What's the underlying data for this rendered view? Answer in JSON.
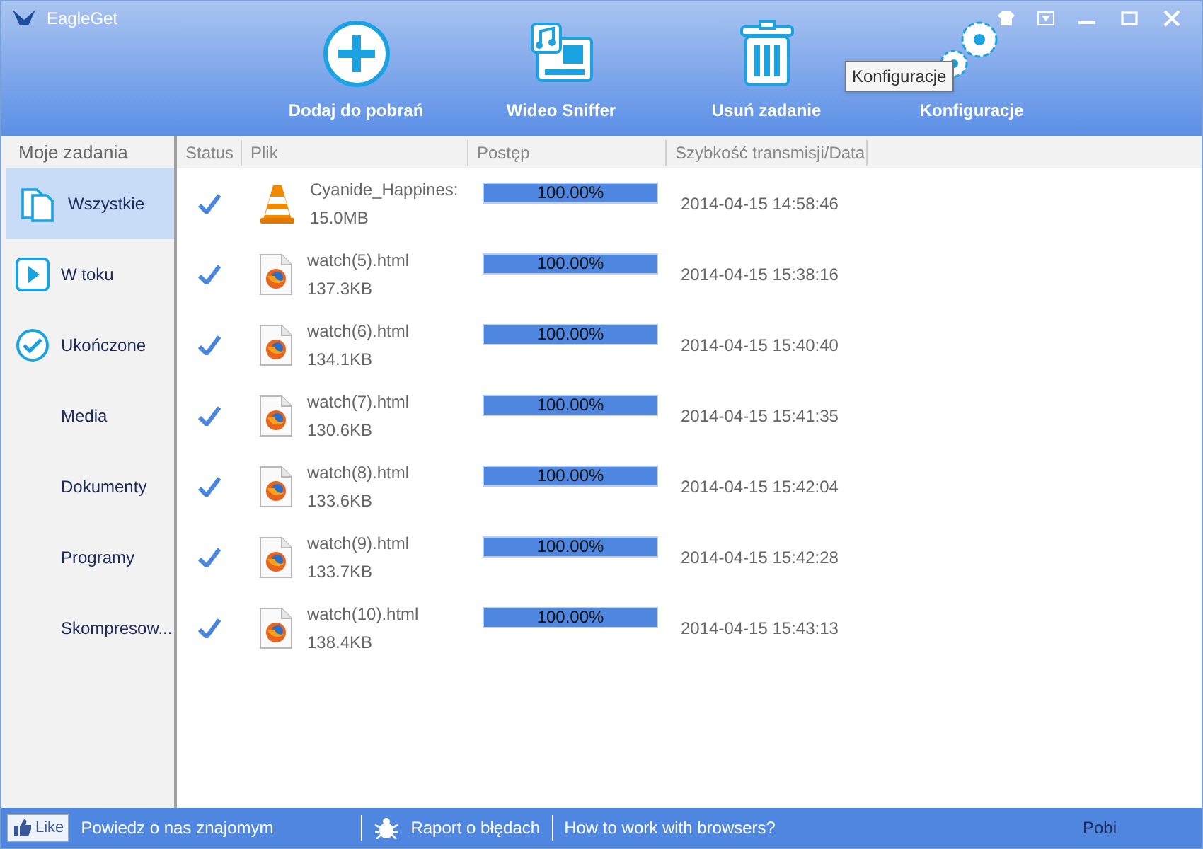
{
  "window": {
    "title": "EagleGet"
  },
  "toolbar": [
    {
      "label": "Dodaj do pobrań",
      "kind": "add"
    },
    {
      "label": "Wideo Sniffer",
      "kind": "sniffer"
    },
    {
      "label": "Usuń zadanie",
      "kind": "delete"
    },
    {
      "label": "Konfiguracje",
      "kind": "settings"
    }
  ],
  "tooltip": "Konfiguracje",
  "sidebar": {
    "title": "Moje zadania",
    "items": [
      {
        "label": "Wszystkie",
        "kind": "all",
        "selected": true
      },
      {
        "label": "W toku",
        "kind": "active",
        "selected": false
      },
      {
        "label": "Ukończone",
        "kind": "done",
        "selected": false
      },
      {
        "label": "Media",
        "kind": "plain",
        "selected": false
      },
      {
        "label": "Dokumenty",
        "kind": "plain",
        "selected": false
      },
      {
        "label": "Programy",
        "kind": "plain",
        "selected": false
      },
      {
        "label": "Skompresow...",
        "kind": "plain",
        "selected": false
      }
    ]
  },
  "table": {
    "columns": [
      "Status",
      "Plik",
      "Postęp",
      "Szybkość transmisji/Data"
    ],
    "rows": [
      {
        "completed": true,
        "kind": "video",
        "name": "Cyanide_Happines:",
        "size": "15.0MB",
        "level": 1,
        "progress": "100.00%",
        "date": "2014-04-15 14:58:46"
      },
      {
        "completed": true,
        "kind": "html",
        "name": "watch(5).html",
        "size": "137.3KB",
        "level": 1,
        "progress": "100.00%",
        "date": "2014-04-15 15:38:16"
      },
      {
        "completed": true,
        "kind": "html",
        "name": "watch(6).html",
        "size": "134.1KB",
        "level": 1,
        "progress": "100.00%",
        "date": "2014-04-15 15:40:40"
      },
      {
        "completed": true,
        "kind": "html",
        "name": "watch(7).html",
        "size": "130.6KB",
        "level": 1,
        "progress": "100.00%",
        "date": "2014-04-15 15:41:35"
      },
      {
        "completed": true,
        "kind": "html",
        "name": "watch(8).html",
        "size": "133.6KB",
        "level": 1,
        "progress": "100.00%",
        "date": "2014-04-15 15:42:04"
      },
      {
        "completed": true,
        "kind": "html",
        "name": "watch(9).html",
        "size": "133.7KB",
        "level": 1,
        "progress": "100.00%",
        "date": "2014-04-15 15:42:28"
      },
      {
        "completed": true,
        "kind": "html",
        "name": "watch(10).html",
        "size": "138.4KB",
        "level": 1,
        "progress": "100.00%",
        "date": "2014-04-15 15:43:13"
      }
    ]
  },
  "status_bar": {
    "like": "Like",
    "share": "Powiedz o nas znajomym",
    "report": "Raport o błędach",
    "help": "How to work with browsers?",
    "speed": "Pobi"
  }
}
